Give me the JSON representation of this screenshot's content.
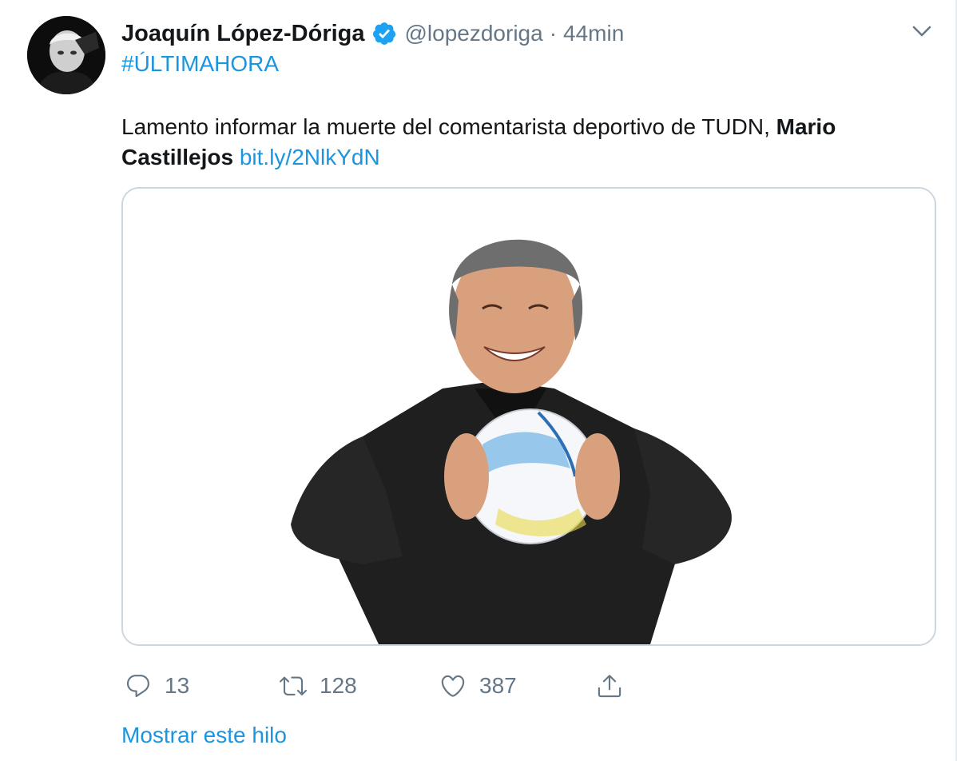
{
  "tweet": {
    "author_name": "Joaquín López-Dóriga",
    "handle": "@lopezdoriga",
    "separator": "·",
    "time": "44min",
    "hashtag": "#ÚLTIMAHORA",
    "text_plain": "Lamento informar la muerte del comentarista deportivo de TUDN,",
    "text_bold": "Mario Castillejos",
    "link": "bit.ly/2NlkYdN"
  },
  "actions": {
    "replies": "13",
    "retweets": "128",
    "likes": "387"
  },
  "show_thread": "Mostrar este hilo",
  "icons": [
    "verified-badge-icon",
    "chevron-down-icon",
    "reply-icon",
    "retweet-icon",
    "like-icon",
    "share-icon"
  ],
  "colors": {
    "accent": "#1b95e0",
    "muted": "#657786",
    "border": "#ccd6dd",
    "text": "#14171a"
  }
}
